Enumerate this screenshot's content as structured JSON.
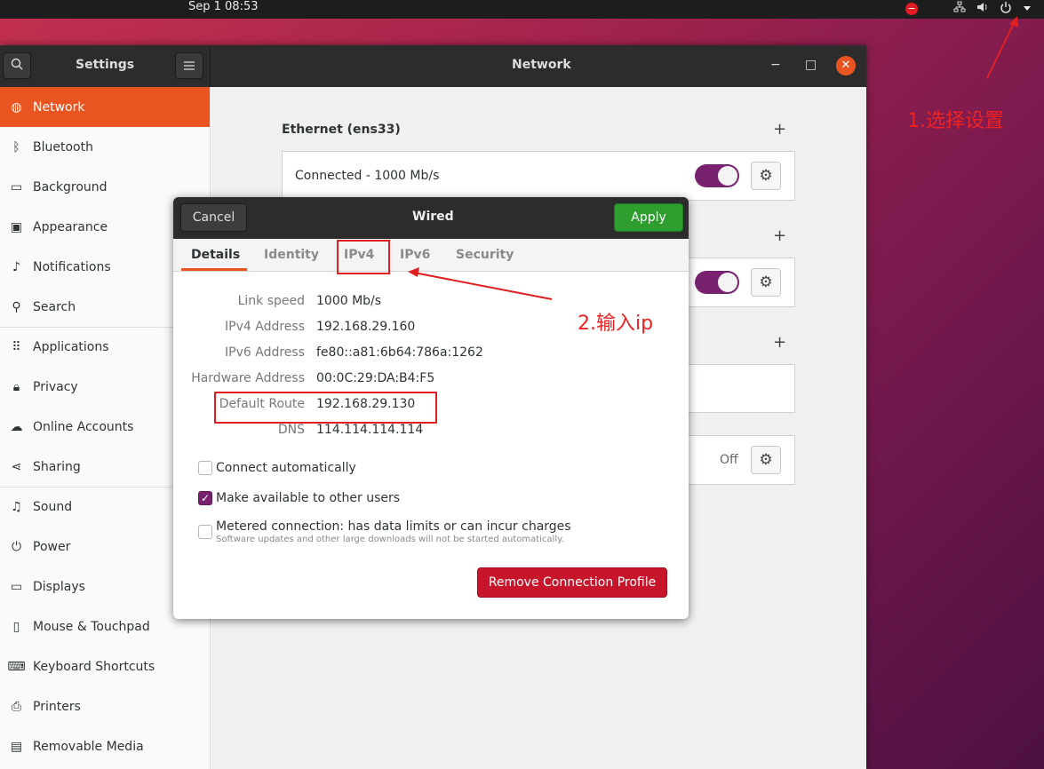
{
  "topbar": {
    "clock": "Sep 1  08:53",
    "tray_icons": [
      "no-entry-icon",
      "network-icon",
      "volume-icon",
      "power-icon",
      "menu-arrow-icon"
    ]
  },
  "window": {
    "sidebar_title": "Settings",
    "title": "Network",
    "minimize": "−",
    "maximize": "□",
    "close": "✕"
  },
  "sidebar": {
    "items": [
      {
        "label": "Network",
        "icon": "network-icon"
      },
      {
        "label": "Bluetooth",
        "icon": "bluetooth-icon"
      },
      {
        "label": "Background",
        "icon": "background-icon"
      },
      {
        "label": "Appearance",
        "icon": "appearance-icon"
      },
      {
        "label": "Notifications",
        "icon": "bell-icon"
      },
      {
        "label": "Search",
        "icon": "search-icon"
      },
      {
        "label": "Applications",
        "icon": "grid-icon"
      },
      {
        "label": "Privacy",
        "icon": "lock-icon"
      },
      {
        "label": "Online Accounts",
        "icon": "cloud-icon"
      },
      {
        "label": "Sharing",
        "icon": "share-icon"
      },
      {
        "label": "Sound",
        "icon": "music-icon"
      },
      {
        "label": "Power",
        "icon": "power-icon"
      },
      {
        "label": "Displays",
        "icon": "display-icon"
      },
      {
        "label": "Mouse & Touchpad",
        "icon": "mouse-icon"
      },
      {
        "label": "Keyboard Shortcuts",
        "icon": "keyboard-icon"
      },
      {
        "label": "Printers",
        "icon": "printer-icon"
      },
      {
        "label": "Removable Media",
        "icon": "media-icon"
      }
    ]
  },
  "network": {
    "ethernet_title": "Ethernet (ens33)",
    "ethernet_status": "Connected - 1000 Mb/s",
    "ethernet_on": true,
    "vpn_on": true,
    "proxy_state": "Off"
  },
  "dialog": {
    "title": "Wired",
    "cancel": "Cancel",
    "apply": "Apply",
    "tabs": [
      "Details",
      "Identity",
      "IPv4",
      "IPv6",
      "Security"
    ],
    "active_tab": "Details",
    "details": [
      {
        "label": "Link speed",
        "value": "1000 Mb/s"
      },
      {
        "label": "IPv4 Address",
        "value": "192.168.29.160"
      },
      {
        "label": "IPv6 Address",
        "value": "fe80::a81:6b64:786a:1262"
      },
      {
        "label": "Hardware Address",
        "value": "00:0C:29:DA:B4:F5"
      },
      {
        "label": "Default Route",
        "value": "192.168.29.130"
      },
      {
        "label": "DNS",
        "value": "114.114.114.114"
      }
    ],
    "connect_automatically": {
      "label": "Connect automatically",
      "checked": false
    },
    "available_to_others": {
      "label": "Make available to other users",
      "checked": true
    },
    "metered": {
      "label": "Metered connection: has data limits or can incur charges",
      "sublabel": "Software updates and other large downloads will not be started automatically.",
      "checked": false
    },
    "remove": "Remove Connection Profile"
  },
  "annotations": {
    "step1": "1.选择设置",
    "step2": "2.输入ip",
    "color": "#e02020"
  },
  "colors": {
    "accent": "#e95420",
    "toggle_on": "#77216f",
    "apply_green": "#2e9f2e",
    "danger": "#c7162b"
  }
}
